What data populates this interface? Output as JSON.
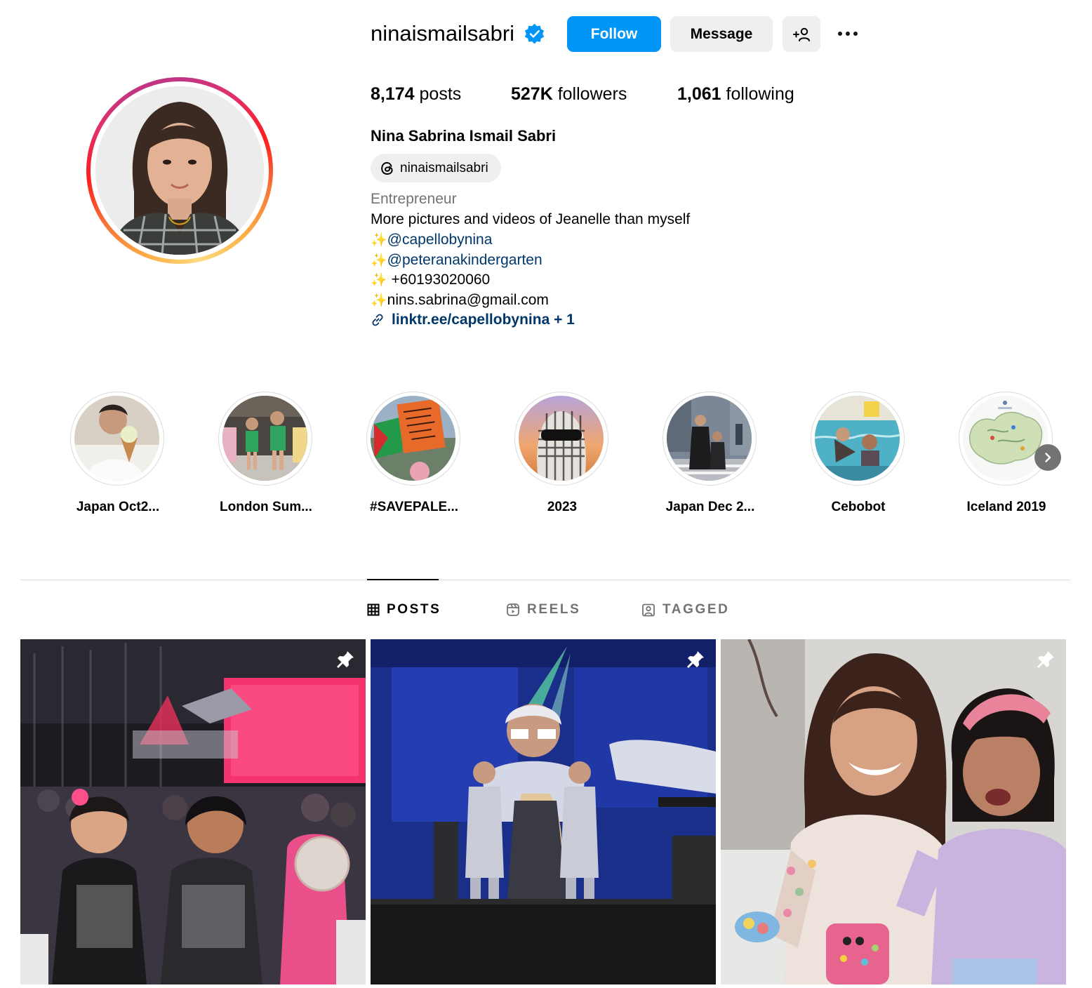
{
  "profile": {
    "username": "ninaismailsabri",
    "verified": true,
    "full_name": "Nina Sabrina Ismail Sabri",
    "threads_handle": "ninaismailsabri",
    "category": "Entrepreneur",
    "bio_lines": [
      "More pictures and videos of Jeanelle than myself",
      "@capellobynina",
      "@peteranakindergarten",
      " +60193020060",
      "nins.sabrina@gmail.com"
    ],
    "sparkle": "✨",
    "link_text": "linktr.ee/capellobynina + 1"
  },
  "buttons": {
    "follow": "Follow",
    "message": "Message"
  },
  "stats": {
    "posts_value": "8,174",
    "posts_label": " posts",
    "followers_value": "527K",
    "followers_label": " followers",
    "following_value": "1,061",
    "following_label": " following"
  },
  "highlights": [
    {
      "label": "Japan Oct2..."
    },
    {
      "label": "London Sum..."
    },
    {
      "label": "#SAVEPALE..."
    },
    {
      "label": "2023"
    },
    {
      "label": "Japan Dec 2..."
    },
    {
      "label": "Cebobot"
    },
    {
      "label": "Iceland 2019"
    }
  ],
  "tabs": {
    "posts": "POSTS",
    "reels": "REELS",
    "tagged": "TAGGED",
    "active": "posts"
  },
  "posts": [
    {
      "type": "photo",
      "pinned": true,
      "subject": "concert-pink-screen"
    },
    {
      "type": "photo",
      "pinned": true,
      "subject": "concert-blue-stage"
    },
    {
      "type": "video",
      "pinned": true,
      "subject": "mother-daughter-indoor"
    }
  ],
  "colors": {
    "follow_button": "#0095f6",
    "secondary_button": "#efefef",
    "link": "#00376b",
    "muted_text": "#737373",
    "verified_badge": "#0095f6"
  }
}
